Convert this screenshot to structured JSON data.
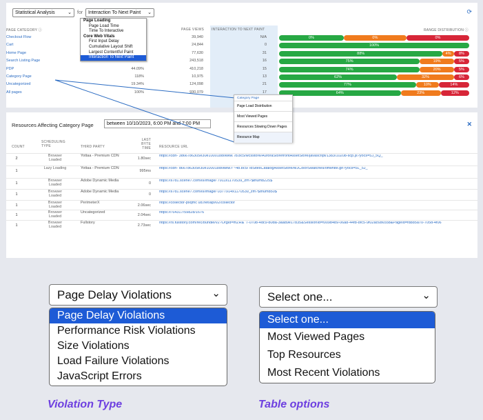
{
  "top": {
    "analysis_select": "Statistical Analysis",
    "for_label": "for",
    "metric_select": "Interaction To Next Paint",
    "dropdown": [
      {
        "label": "Page Loading",
        "group": true
      },
      {
        "label": "Page Load Time"
      },
      {
        "label": "Time To Interactive"
      },
      {
        "label": "Core Web Vitals",
        "group": true
      },
      {
        "label": "First Input Delay"
      },
      {
        "label": "Cumulative Layout Shift"
      },
      {
        "label": "Largest Contentful Paint"
      },
      {
        "label": "Interaction To Next Paint",
        "selected": true
      }
    ],
    "headers": {
      "page_category": "PAGE CATEGORY ⓘ",
      "page_views": "PAGE VIEWS",
      "interaction": "INTERACTION TO NEXT PAINT",
      "range": "RANGE DISTRIBUTION ⓘ"
    },
    "rows": [
      {
        "name": "Checkout Flow",
        "pct": "",
        "views": "39,940",
        "inp": "N/A",
        "dist": [
          {
            "v": "0%",
            "c": "#27a844",
            "w": 34
          },
          {
            "v": "0%",
            "c": "#f07b1d",
            "w": 33
          },
          {
            "v": "0%",
            "c": "#d72638",
            "w": 33
          }
        ]
      },
      {
        "name": "Cart",
        "pct": "",
        "views": "24,844",
        "inp": "0",
        "dist": [
          {
            "v": "100%",
            "c": "#27a844",
            "w": 100
          }
        ]
      },
      {
        "name": "Home Page",
        "pct": "",
        "views": "77,630",
        "inp": "31",
        "dist": [
          {
            "v": "88%",
            "c": "#27a844",
            "w": 86
          },
          {
            "v": "4%",
            "c": "#f07b1d",
            "w": 6
          },
          {
            "v": "8%",
            "c": "#d72638",
            "w": 8
          }
        ]
      },
      {
        "name": "Search Listing Page",
        "pct": "",
        "views": "243,518",
        "inp": "16",
        "dist": [
          {
            "v": "75%",
            "c": "#27a844",
            "w": 74
          },
          {
            "v": "19%",
            "c": "#f07b1d",
            "w": 18
          },
          {
            "v": "5%",
            "c": "#d72638",
            "w": 8
          }
        ]
      },
      {
        "name": "PDP",
        "pct": "44.09%",
        "views": "410,218",
        "inp": "15",
        "dist": [
          {
            "v": "74%",
            "c": "#27a844",
            "w": 74
          },
          {
            "v": "20%",
            "c": "#f07b1d",
            "w": 18
          },
          {
            "v": "5%",
            "c": "#d72638",
            "w": 8
          }
        ]
      },
      {
        "name": "Category Page",
        "pct": "118%",
        "views": "10,975",
        "inp": "13",
        "dist": [
          {
            "v": "62%",
            "c": "#27a844",
            "w": 62
          },
          {
            "v": "32%",
            "c": "#f07b1d",
            "w": 30
          },
          {
            "v": "6%",
            "c": "#d72638",
            "w": 8
          }
        ]
      },
      {
        "name": "Uncategorized",
        "pct": "19.34%",
        "views": "124,098",
        "inp": "21",
        "dist": [
          {
            "v": "77%",
            "c": "#27a844",
            "w": 72
          },
          {
            "v": "10%",
            "c": "#f07b1d",
            "w": 12
          },
          {
            "v": "14%",
            "c": "#d72638",
            "w": 16
          }
        ]
      },
      {
        "name": "All pages",
        "pct": "100%",
        "views": "930,079",
        "inp": "17",
        "dist": [
          {
            "v": "64%",
            "c": "#27a844",
            "w": 64
          },
          {
            "v": "23%",
            "c": "#f07b1d",
            "w": 21
          },
          {
            "v": "12%",
            "c": "#d72638",
            "w": 15
          }
        ]
      }
    ],
    "context_menu": {
      "title": "Category Page",
      "items": [
        "Page Load Distribution",
        "Most Viewed Pages",
        "Resources Slowing Down Pages",
        "Resource Map"
      ]
    }
  },
  "resources": {
    "title": "Resources Affecting Category Page",
    "range": "between 10/10/2023, 6:00 PM and 7:00 PM",
    "headers": {
      "count": "COUNT",
      "type": "SCHEDULING TYPE",
      "third": "THIRD PARTY",
      "byte": "LAST BYTE TIME",
      "url": "RESOURCE URL"
    },
    "rows": [
      {
        "count": "2",
        "type": "Browser Loaded",
        "third": "Yottaa - Premium CDN",
        "byte": "1.80sec",
        "url": "https://cdn-                3d66786305e30e100018d/www.                    /b.bc5/wcsstore/AuroraStorefrontAssetStore/javascript/1383/10208-scp.js?yocs=5J_5Q_"
      },
      {
        "count": "1",
        "type": "Lazy Loading",
        "third": "Yottaa - Premium CDN",
        "byte": "995ms",
        "url": "https://cdn-          d66786305e30e100018d/www.r              ~4b.bc5/                  /dSitesCatalogAssetStore/MJColorSwatches/offwhite.gif?yocs=5L_5J_"
      },
      {
        "count": "1",
        "type": "Browser Loaded",
        "third": "Adobe Dynamic Media",
        "byte": "0",
        "url": "https://s7d1.scene7.com/is/image/                7911x1170539_zm?$thumb225$"
      },
      {
        "count": "1",
        "type": "Browser Loaded",
        "third": "Adobe Dynamic Media",
        "byte": "0",
        "url": "https://s7d1.scene7.com/is/image/                0377914x1170539_zm?$thumb50$"
      },
      {
        "count": "1",
        "type": "Browser Loaded",
        "third": "PerimeterX",
        "byte": "2.06sec",
        "url": "https://collector-pxqmc                  ud.net/api/v2/collector"
      },
      {
        "count": "1",
        "type": "Browser Loaded",
        "third": "Uncategorized",
        "byte": "2.04sec",
        "url": "https://i                 64317/59828/1676"
      },
      {
        "count": "1",
        "type": "Browser Loaded",
        "third": "Fullstory",
        "byte": "2.73sec",
        "url": "https://rs.fullstory.com/rec/bundle/v2?OrgId=mZR&                   '7-070b-4dc9-b0da-3aad9e17b35&SessionId=f009b4b9-06a8-44fb-8fc5-9f02ac6b655b&PageId=fd885a70-705d-4f06"
      }
    ]
  },
  "bottom": {
    "violation_select": "Page Delay Violations",
    "violation_options": [
      "Page Delay Violations",
      "Performance Risk Violations",
      "Size Violations",
      "Load Failure Violations",
      "JavaScript Errors"
    ],
    "violation_caption": "Violation Type",
    "table_select": "Select one...",
    "table_options": [
      "Select one...",
      "Most Viewed Pages",
      "Top Resources",
      "Most Recent Violations"
    ],
    "table_caption": "Table options",
    "ghost_text": "Select"
  }
}
